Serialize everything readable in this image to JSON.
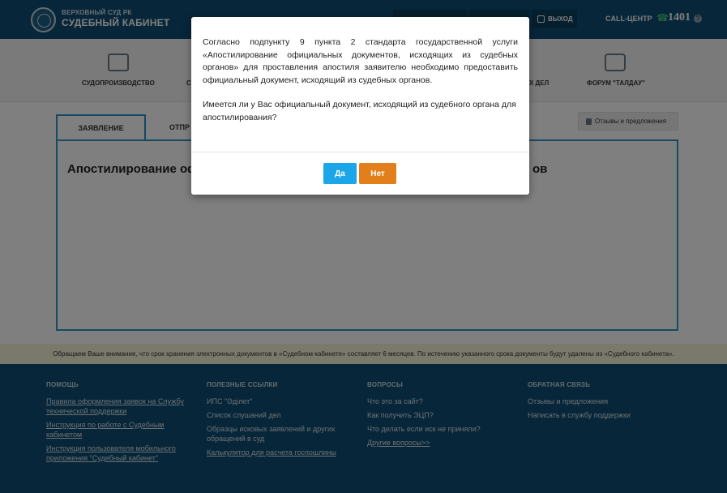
{
  "header": {
    "logo_sub": "ВЕРХОВНЫЙ СУД РК",
    "logo_title": "СУДЕБНЫЙ КАБИНЕТ",
    "exit_label": "ВЫХОД",
    "call_label": "CALL-ЦЕНТР",
    "call_number": "1401",
    "help_glyph": "?"
  },
  "nav": {
    "items": [
      {
        "label": "СУДОПРОИЗВОДСТВО",
        "icon": "briefcase-icon"
      },
      {
        "label": "С",
        "icon": "document-icon"
      },
      {
        "label": "Х ДЕЛ",
        "icon": "folder-icon"
      },
      {
        "label": "ФОРУМ \"ТАЛДАУ\"",
        "icon": "chat-icon"
      }
    ]
  },
  "main": {
    "tabs": [
      {
        "label": "ЗАЯВЛЕНИЕ"
      },
      {
        "label": "ОТПР"
      }
    ],
    "feedback_label": "Отзывы и предложения",
    "panel_title_left": "Апостилирование оф",
    "panel_title_right": "ов"
  },
  "notice": "Обращаем Ваше внимание, что срок хранения электронных документов в «Судебном кабинете» составляет 6 месяцев. По истечению указанного срока документы будут удалены из «Судебного кабинета».",
  "footer": {
    "columns": [
      {
        "heading": "ПОМОЩЬ",
        "links": [
          "Правила оформления заявок на Службу технической поддержки",
          "Инструкция по работе с Судебным кабинетом",
          "Инструкция пользователя мобильного приложения \"Судебный кабинет\""
        ]
      },
      {
        "heading": "ПОЛЕЗНЫЕ ССЫЛКИ",
        "links": [
          "ИПС \"Әділет\"",
          "Список слушаний дел",
          "Образцы исковых заявлений и других обращений в суд",
          "Калькулятор для расчета госпошлины"
        ]
      },
      {
        "heading": "ВОПРОСЫ",
        "links": [
          "Что это за сайт?",
          "Как получить ЭЦП?",
          "Что делать если иск не приняли?",
          "Другие вопросы>>"
        ]
      },
      {
        "heading": "ОБРАТНАЯ СВЯЗЬ",
        "links": [
          "Отзывы и предложения",
          "Написать в службу поддержки"
        ]
      }
    ]
  },
  "modal": {
    "paragraph1": "Согласно подпункту 9 пункта 2 стандарта государственной услуги «Апостилирование официальных документов, исходящих из судебных органов» для проставления апостиля заявителю необходимо предоставить официальный документ, исходящий из судебных органов.",
    "paragraph2": "Имеется ли у Вас официальный документ, исходящий из судебного органа для апостилирования?",
    "yes_label": "Да",
    "no_label": "Нет"
  },
  "colors": {
    "header_bg": "#0e4d72",
    "accent_blue": "#2a93c9",
    "yes_button": "#1aa6e8",
    "no_button": "#e37f1b",
    "notice_bg": "#f7f0d9"
  }
}
